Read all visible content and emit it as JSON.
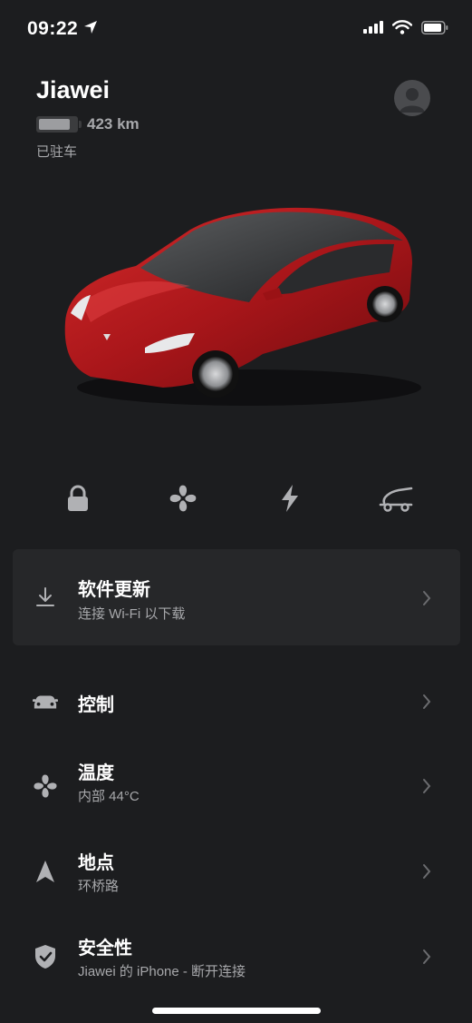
{
  "status_bar": {
    "time": "09:22"
  },
  "header": {
    "car_name": "Jiawei",
    "range": "423 km",
    "battery_level": 0.85,
    "status": "已驻车"
  },
  "quick_actions": [
    {
      "icon": "lock-icon"
    },
    {
      "icon": "fan-icon"
    },
    {
      "icon": "bolt-icon"
    },
    {
      "icon": "frunk-icon"
    }
  ],
  "update_card": {
    "title": "软件更新",
    "subtitle": "连接 Wi-Fi 以下载",
    "icon": "download-icon"
  },
  "menu": [
    {
      "title": "控制",
      "subtitle": "",
      "icon": "car-icon"
    },
    {
      "title": "温度",
      "subtitle": "内部 44°C",
      "icon": "fan-icon"
    },
    {
      "title": "地点",
      "subtitle": "环桥路",
      "icon": "navigation-arrow-icon"
    },
    {
      "title": "安全性",
      "subtitle": "Jiawei 的 iPhone - 断开连接",
      "icon": "shield-check-icon"
    }
  ],
  "colors": {
    "background": "#1c1d1f",
    "card": "#262729",
    "secondary_text": "#a7a8ab",
    "car_red": "#b01a1d"
  }
}
